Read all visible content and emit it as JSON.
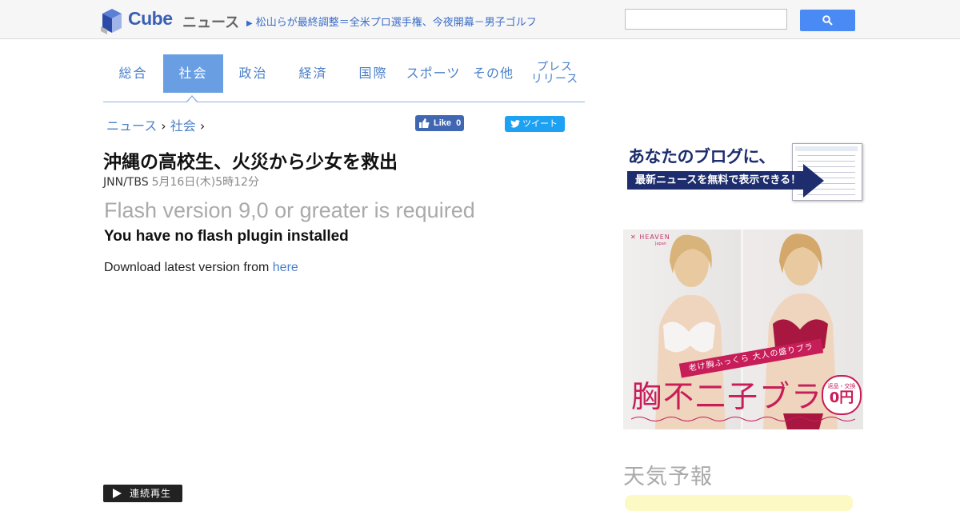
{
  "header": {
    "logo_text": "Cube",
    "logo_sub": "ニュース",
    "top_headline": "松山らが最終調整＝全米プロ選手権、今夜開幕－男子ゴルフ",
    "search": {
      "placeholder": "",
      "value": ""
    },
    "search_button_icon": "search-icon"
  },
  "tabs": [
    {
      "label": "総合",
      "active": false
    },
    {
      "label": "社会",
      "active": true
    },
    {
      "label": "政治",
      "active": false
    },
    {
      "label": "経済",
      "active": false
    },
    {
      "label": "国際",
      "active": false
    },
    {
      "label": "スポーツ",
      "active": false
    },
    {
      "label": "その他",
      "active": false
    },
    {
      "label_line1": "プレス",
      "label_line2": "リリース",
      "active": false
    }
  ],
  "breadcrumb": {
    "root": "ニュース",
    "sep": "›",
    "current": "社会"
  },
  "social": {
    "like_label": "Like",
    "like_count": "0",
    "tweet_label": "ツイート"
  },
  "article": {
    "title": "沖縄の高校生、火災から少女を救出",
    "source": "JNN/TBS",
    "date": "5月16日(木)5時12分"
  },
  "player": {
    "flash_required": "Flash version 9,0 or greater is required",
    "no_plugin": "You have no flash plugin installed",
    "download_prefix": "Download latest version from ",
    "download_link": "here",
    "continuous_play": "連続再生"
  },
  "sidebar": {
    "blog_banner": {
      "headline": "あなたのブログに、",
      "bar_text": "最新ニュースを無料で表示できる！"
    },
    "ad": {
      "brand": "HEAVEN",
      "brand_sub": "Japan",
      "ribbon": "老け胸ふっくら 大人の盛りブラ",
      "product": "胸不二子ブラ",
      "badge_top": "返品・交換",
      "badge_price": "0円"
    },
    "weather_title": "天気予報"
  },
  "colors": {
    "accent": "#6a9ee3",
    "link": "#4a7fc8",
    "facebook": "#4267b2",
    "twitter": "#1da1f2",
    "ad_pink": "#c71d58"
  }
}
